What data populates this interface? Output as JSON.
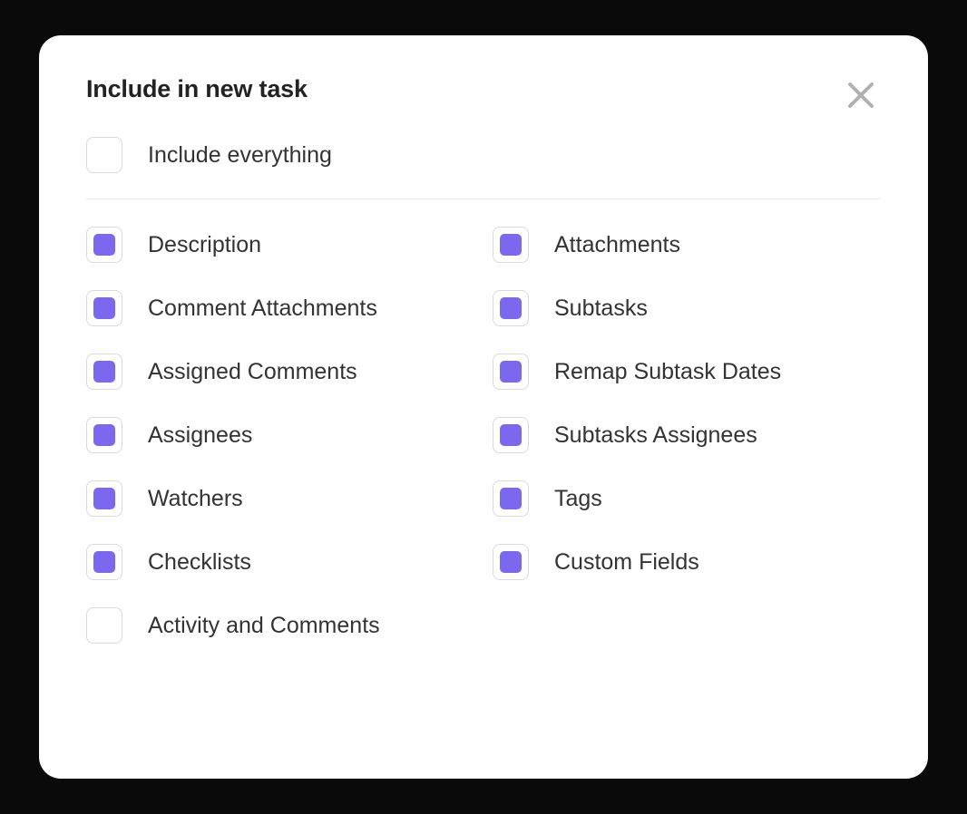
{
  "dialog": {
    "title": "Include in new task",
    "include_everything": {
      "label": "Include everything",
      "checked": false
    },
    "left_column": [
      {
        "label": "Description",
        "checked": true
      },
      {
        "label": "Comment Attachments",
        "checked": true
      },
      {
        "label": "Assigned Comments",
        "checked": true
      },
      {
        "label": "Assignees",
        "checked": true
      },
      {
        "label": "Watchers",
        "checked": true
      },
      {
        "label": "Checklists",
        "checked": true
      },
      {
        "label": "Activity and Comments",
        "checked": false
      }
    ],
    "right_column": [
      {
        "label": "Attachments",
        "checked": true
      },
      {
        "label": "Subtasks",
        "checked": true
      },
      {
        "label": "Remap Subtask Dates",
        "checked": true
      },
      {
        "label": "Subtasks Assignees",
        "checked": true
      },
      {
        "label": "Tags",
        "checked": true
      },
      {
        "label": "Custom Fields",
        "checked": true
      }
    ]
  },
  "colors": {
    "accent": "#7b68ee",
    "border": "#d9d9d9",
    "text": "#333333",
    "divider": "#e8e8e8"
  }
}
